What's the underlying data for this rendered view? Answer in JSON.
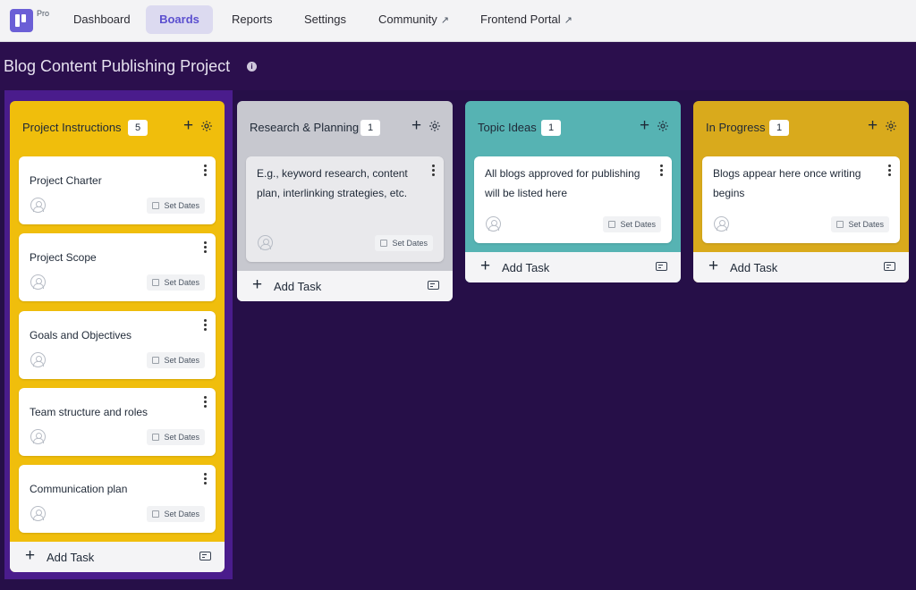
{
  "nav": {
    "pro_badge": "Pro",
    "items": [
      {
        "label": "Dashboard"
      },
      {
        "label": "Boards"
      },
      {
        "label": "Reports"
      },
      {
        "label": "Settings"
      },
      {
        "label": "Community"
      },
      {
        "label": "Frontend Portal"
      }
    ],
    "external_glyph": "↗"
  },
  "project": {
    "title": "Blog Content Publishing Project",
    "info_glyph": "i"
  },
  "columns": [
    {
      "title": "Project Instructions",
      "count": "5",
      "color": "#f0be0c",
      "cards": [
        {
          "title": "Project Charter",
          "date_label": "Set Dates"
        },
        {
          "title": "Project Scope",
          "date_label": "Set Dates"
        },
        {
          "title": "Goals and Objectives",
          "date_label": "Set Dates"
        },
        {
          "title": "Team structure and roles",
          "date_label": "Set Dates"
        },
        {
          "title": "Communication plan",
          "date_label": "Set Dates"
        }
      ],
      "add_label": "Add Task"
    },
    {
      "title": "Research & Planning",
      "count": "1",
      "color": "#c7c8cf",
      "cards": [
        {
          "title": "E.g., keyword research, content plan, interlinking strategies, etc.",
          "date_label": "Set Dates"
        }
      ],
      "add_label": "Add Task"
    },
    {
      "title": "Topic Ideas",
      "count": "1",
      "color": "#56b3b3",
      "cards": [
        {
          "title": "All blogs approved for publishing will be listed here",
          "date_label": "Set Dates"
        }
      ],
      "add_label": "Add Task"
    },
    {
      "title": "In Progress",
      "count": "1",
      "color": "#d9aa1c",
      "cards": [
        {
          "title": "Blogs appear here once writing begins",
          "date_label": "Set Dates"
        }
      ],
      "add_label": "Add Task"
    }
  ],
  "icons": {
    "plus": "+",
    "gear": "gear-icon",
    "calendar": "calendar-icon",
    "user": "user-icon"
  }
}
